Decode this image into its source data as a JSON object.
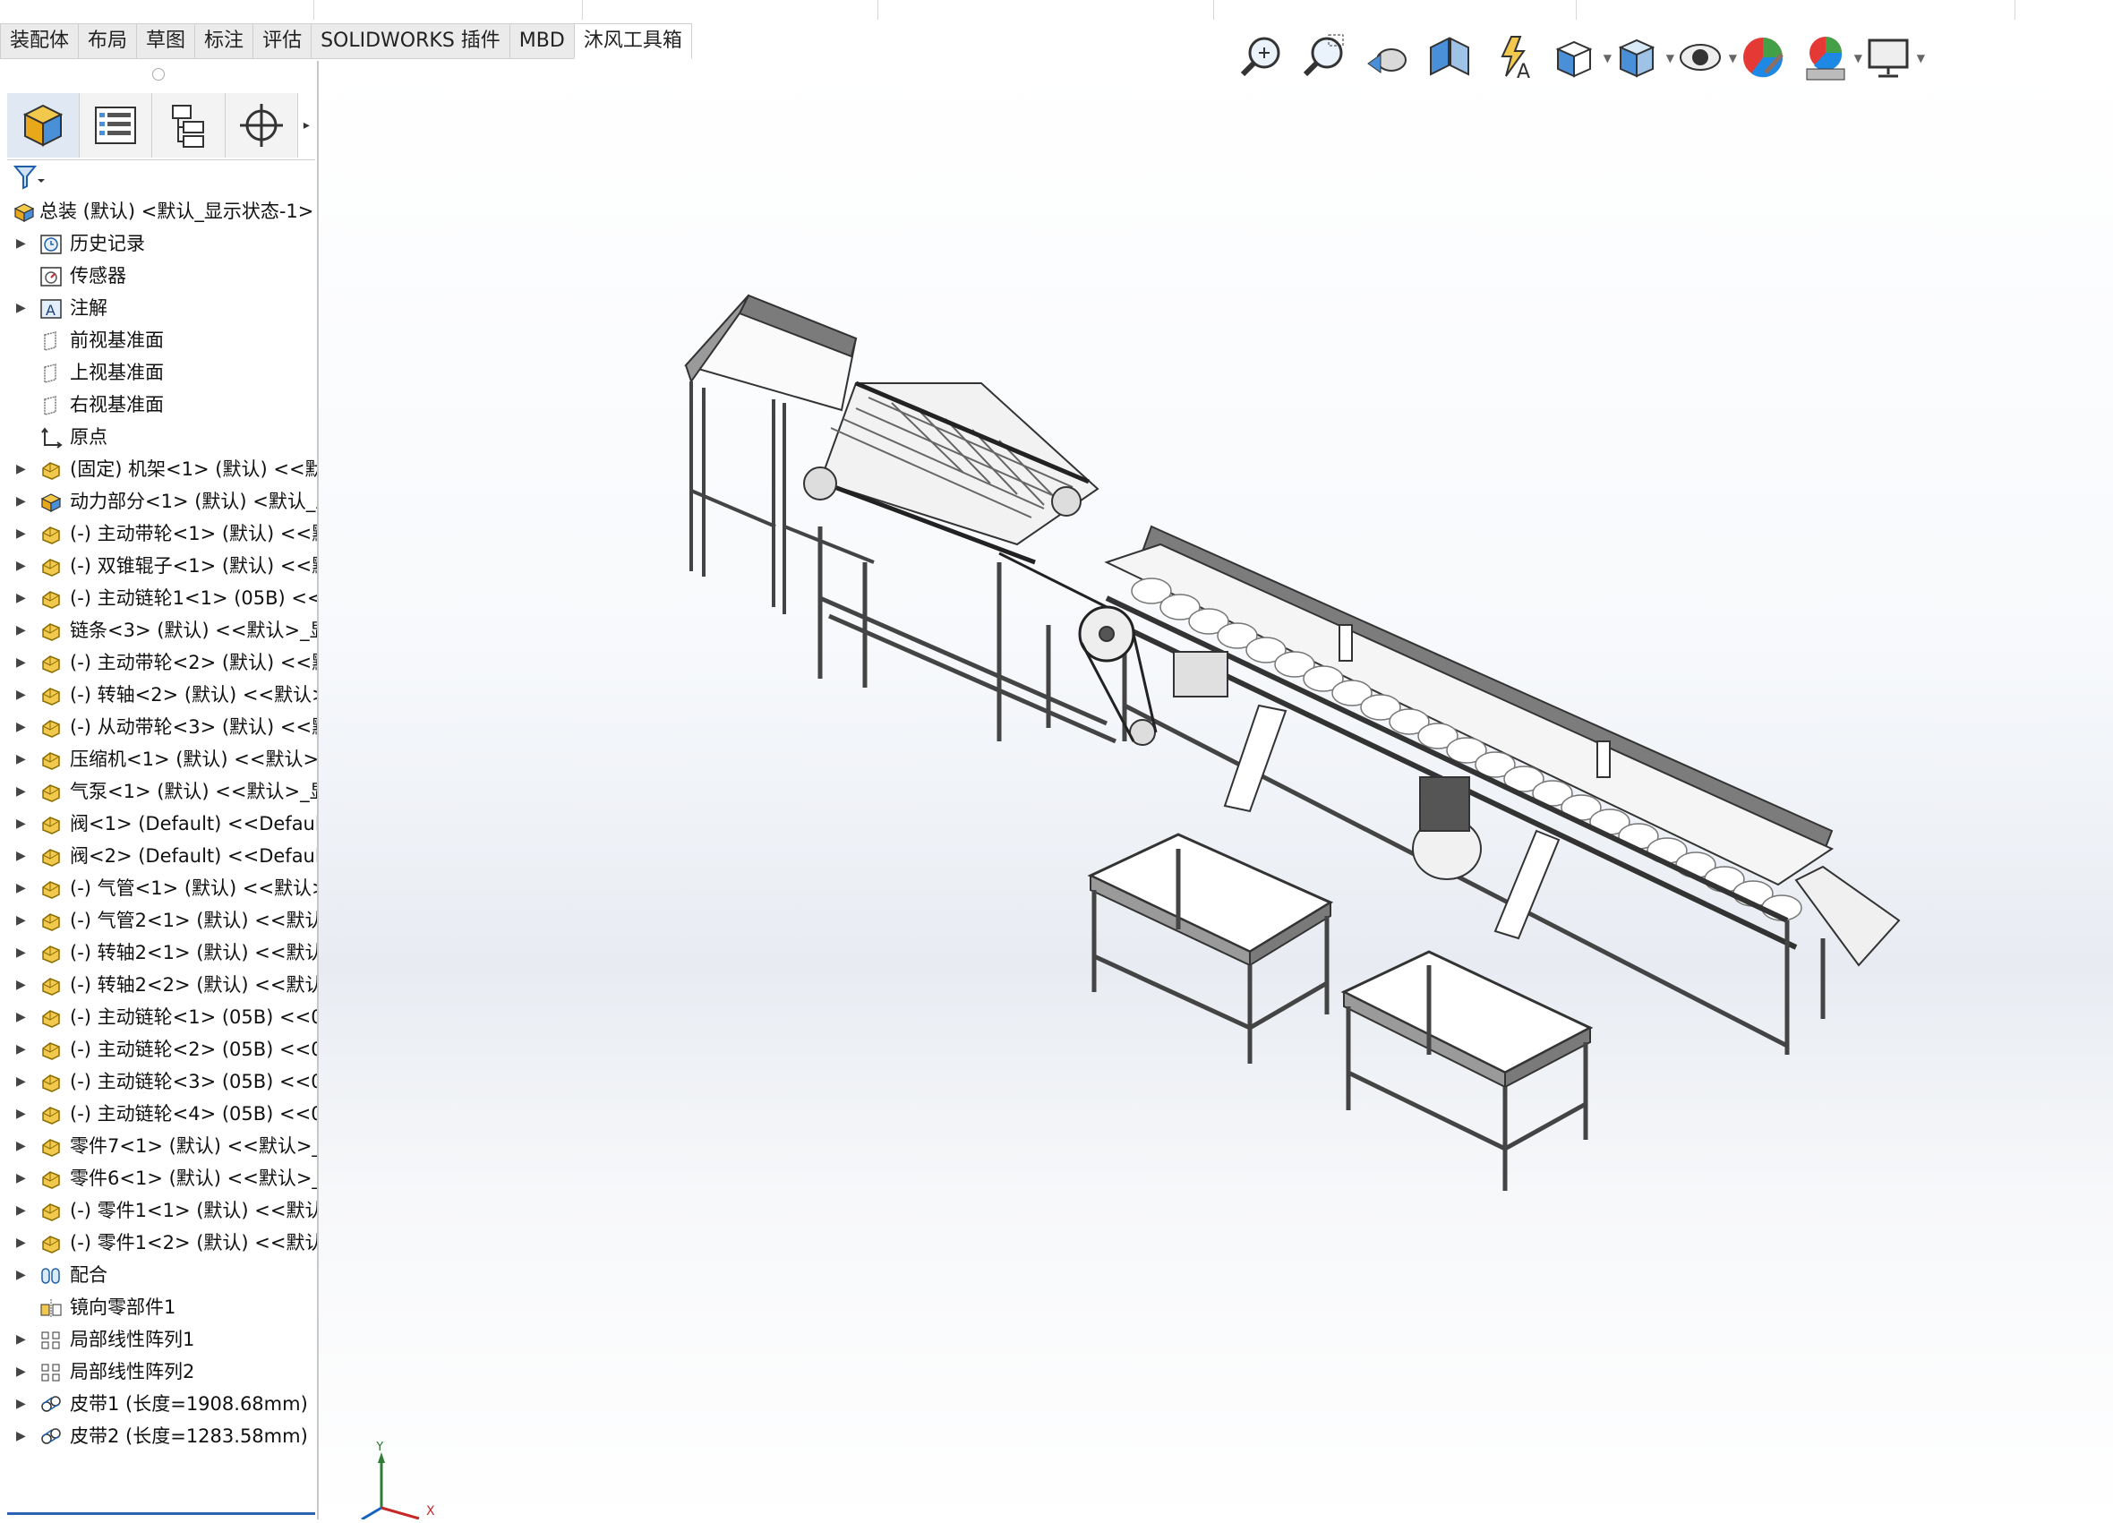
{
  "tabs": [
    {
      "label": "装配体"
    },
    {
      "label": "布局"
    },
    {
      "label": "草图"
    },
    {
      "label": "标注"
    },
    {
      "label": "评估"
    },
    {
      "label": "SOLIDWORKS 插件"
    },
    {
      "label": "MBD"
    },
    {
      "label": "沐风工具箱",
      "active": true
    }
  ],
  "hud_icons": [
    "zoom-to-fit-icon",
    "zoom-to-area-icon",
    "previous-view-icon",
    "section-view-icon",
    "dynamic-annotation-icon",
    "view-orientation-icon",
    "display-style-icon",
    "hide-show-items-icon",
    "edit-appearance-icon",
    "apply-scene-icon",
    "view-settings-icon"
  ],
  "feature_tree": {
    "root": "总装 (默认) <默认_显示状态-1>",
    "items": [
      {
        "label": "历史记录",
        "icon": "history-icon",
        "expand": true
      },
      {
        "label": "传感器",
        "icon": "sensor-icon",
        "expand": false
      },
      {
        "label": "注解",
        "icon": "annotation-icon",
        "expand": true
      },
      {
        "label": "前视基准面",
        "icon": "plane-icon",
        "expand": false
      },
      {
        "label": "上视基准面",
        "icon": "plane-icon",
        "expand": false
      },
      {
        "label": "右视基准面",
        "icon": "plane-icon",
        "expand": false
      },
      {
        "label": "原点",
        "icon": "origin-icon",
        "expand": false
      },
      {
        "label": "(固定) 机架<1> (默认) <<默",
        "icon": "part-icon",
        "expand": true
      },
      {
        "label": "动力部分<1> (默认) <默认_显",
        "icon": "subassembly-icon",
        "expand": true
      },
      {
        "label": "(-) 主动带轮<1> (默认) <<默",
        "icon": "part-icon",
        "expand": true
      },
      {
        "label": "(-) 双锥辊子<1> (默认) <<默",
        "icon": "part-icon",
        "expand": true
      },
      {
        "label": "(-) 主动链轮1<1> (05B) <<0",
        "icon": "part-icon",
        "expand": true
      },
      {
        "label": "链条<3> (默认) <<默认>_显",
        "icon": "part-icon",
        "expand": true
      },
      {
        "label": "(-) 主动带轮<2> (默认) <<默",
        "icon": "part-icon",
        "expand": true
      },
      {
        "label": "(-) 转轴<2> (默认) <<默认>",
        "icon": "part-icon",
        "expand": true
      },
      {
        "label": "(-) 从动带轮<3> (默认) <<默",
        "icon": "part-icon",
        "expand": true
      },
      {
        "label": "压缩机<1> (默认) <<默认>_",
        "icon": "part-icon",
        "expand": true
      },
      {
        "label": "气泵<1> (默认) <<默认>_显",
        "icon": "part-icon",
        "expand": true
      },
      {
        "label": "阀<1> (Default) <<Default",
        "icon": "part-icon",
        "expand": true
      },
      {
        "label": "阀<2> (Default) <<Default",
        "icon": "part-icon",
        "expand": true
      },
      {
        "label": "(-) 气管<1> (默认) <<默认>",
        "icon": "part-icon",
        "expand": true
      },
      {
        "label": "(-) 气管2<1> (默认) <<默认",
        "icon": "part-icon",
        "expand": true
      },
      {
        "label": "(-) 转轴2<1> (默认) <<默认",
        "icon": "part-icon",
        "expand": true
      },
      {
        "label": "(-) 转轴2<2> (默认) <<默认",
        "icon": "part-icon",
        "expand": true
      },
      {
        "label": "(-) 主动链轮<1> (05B) <<05",
        "icon": "part-icon",
        "expand": true
      },
      {
        "label": "(-) 主动链轮<2> (05B) <<05",
        "icon": "part-icon",
        "expand": true
      },
      {
        "label": "(-) 主动链轮<3> (05B) <<05",
        "icon": "part-icon",
        "expand": true
      },
      {
        "label": "(-) 主动链轮<4> (05B) <<05",
        "icon": "part-icon",
        "expand": true
      },
      {
        "label": "零件7<1> (默认) <<默认>_显",
        "icon": "part-icon",
        "expand": true
      },
      {
        "label": "零件6<1> (默认) <<默认>_显",
        "icon": "part-icon",
        "expand": true
      },
      {
        "label": "(-) 零件1<1> (默认) <<默认",
        "icon": "part-icon",
        "expand": true
      },
      {
        "label": "(-) 零件1<2> (默认) <<默认",
        "icon": "part-icon",
        "expand": true
      },
      {
        "label": "配合",
        "icon": "mates-icon",
        "expand": true
      },
      {
        "label": "镜向零部件1",
        "icon": "mirror-icon",
        "expand": false
      },
      {
        "label": "局部线性阵列1",
        "icon": "pattern-icon",
        "expand": true
      },
      {
        "label": "局部线性阵列2",
        "icon": "pattern-icon",
        "expand": true
      },
      {
        "label": "皮带1 (长度=1908.68mm)",
        "icon": "belt-icon",
        "expand": true
      },
      {
        "label": "皮带2 (长度=1283.58mm)",
        "icon": "belt-icon",
        "expand": true
      }
    ]
  },
  "triad": {
    "y_label": "Y",
    "x_label": "X"
  },
  "colors": {
    "accent": "#2a64b4",
    "part_yellow": "#f0c020",
    "assembly_blue": "#4a90d9",
    "model_gray": "#555555"
  }
}
